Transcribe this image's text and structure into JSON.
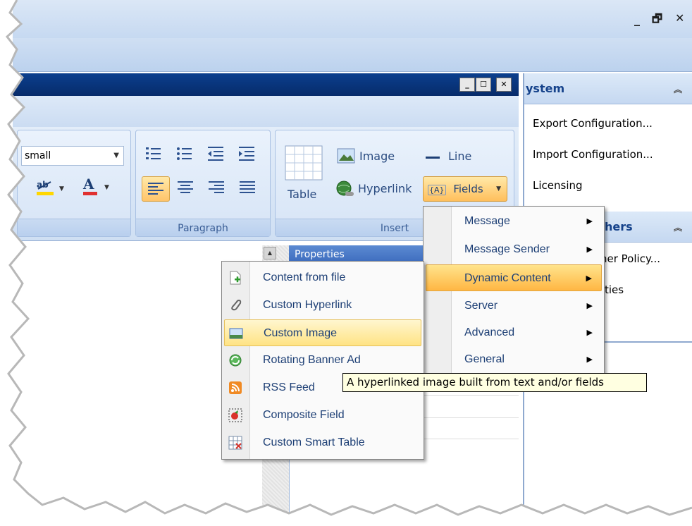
{
  "window_controls": {
    "minimize": "_",
    "restore": "🗗",
    "close": "✕"
  },
  "inner_window": {
    "minimize": "_",
    "maximize": "☐",
    "close": "✕"
  },
  "ribbon": {
    "font_size_value": "small",
    "groups": {
      "paragraph": "Paragraph",
      "insert": "Insert"
    },
    "insert": {
      "table": "Table",
      "image": "Image",
      "line": "Line",
      "hyperlink": "Hyperlink",
      "fields": "Fields",
      "fields_icon_text": "{A}"
    }
  },
  "right_panel": {
    "system_header": "ystem",
    "system_items": [
      "Export Configuration...",
      "Import Configuration...",
      "Licensing"
    ],
    "others_header": "hers",
    "others_items": [
      "her Policy...",
      "ties"
    ]
  },
  "properties_header": "Properties",
  "fields_menu": {
    "items": [
      "Message",
      "Message Sender",
      "Dynamic Content",
      "Server",
      "Advanced",
      "General"
    ],
    "highlighted": "Dynamic Content"
  },
  "dynamic_content_menu": {
    "items": [
      {
        "label": "Content from file",
        "icon": "file-add-icon"
      },
      {
        "label": "Custom Hyperlink",
        "icon": "paperclip-link-icon"
      },
      {
        "label": "Custom Image",
        "icon": "picture-icon"
      },
      {
        "label": "Rotating Banner Ad",
        "icon": "rotate-arrows-icon"
      },
      {
        "label": "RSS Feed",
        "icon": "rss-icon"
      },
      {
        "label": "Composite Field",
        "icon": "composite-field-icon"
      },
      {
        "label": "Custom Smart Table",
        "icon": "smart-table-icon"
      }
    ],
    "highlighted": "Custom Image"
  },
  "tooltip": "A hyperlinked image built from text and/or fields",
  "colors": {
    "highlight": "#ffb643",
    "title_blue": "#072b6a",
    "text_blue": "#1d3f75"
  }
}
